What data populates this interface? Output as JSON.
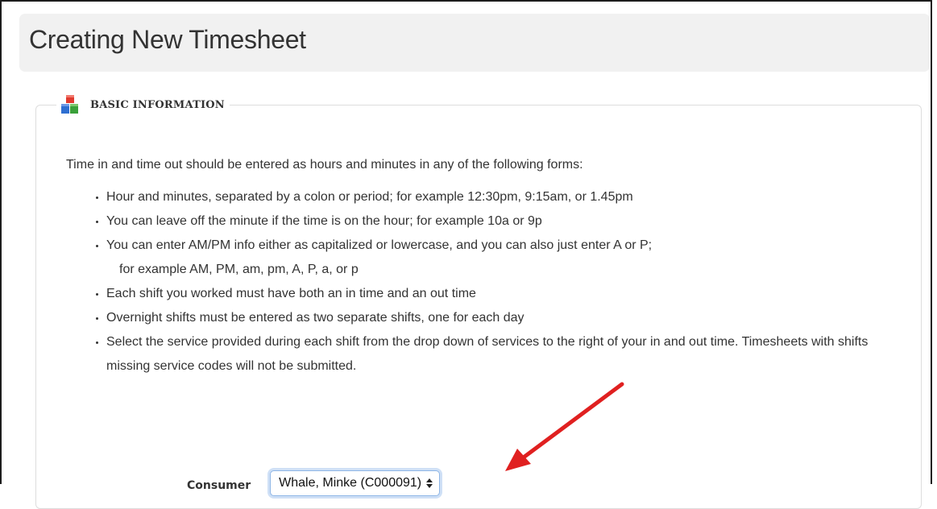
{
  "header": {
    "title": "Creating New Timesheet"
  },
  "section": {
    "title": "BASIC INFORMATION",
    "icon": "building-blocks-icon",
    "icon_colors": {
      "red": "#e03a2f",
      "blue": "#2f6fd1",
      "green": "#3aa03a"
    }
  },
  "instructions": {
    "intro": "Time in and time out should be entered as hours and minutes in any of the following forms:",
    "items": [
      "Hour and minutes, separated by a colon or period; for example 12:30pm, 9:15am, or 1.45pm",
      "You can leave off the minute if the time is on the hour; for example 10a or 9p",
      "You can enter AM/PM info either as capitalized or lowercase, and you can also just enter A or P;",
      "Each shift you worked must have both an in time and an out time",
      "Overnight shifts must be entered as two separate shifts, one for each day",
      "Select the service provided during each shift from the drop down of services to the right of your in and out time. Timesheets with shifts missing service codes will not be submitted."
    ],
    "item3_continuation": "for example AM, PM, am, pm, A, P, a, or p"
  },
  "form": {
    "consumer_label": "Consumer",
    "consumer_value": "Whale, Minke (C000091)"
  },
  "annotation": {
    "arrow_color": "#e02020"
  }
}
